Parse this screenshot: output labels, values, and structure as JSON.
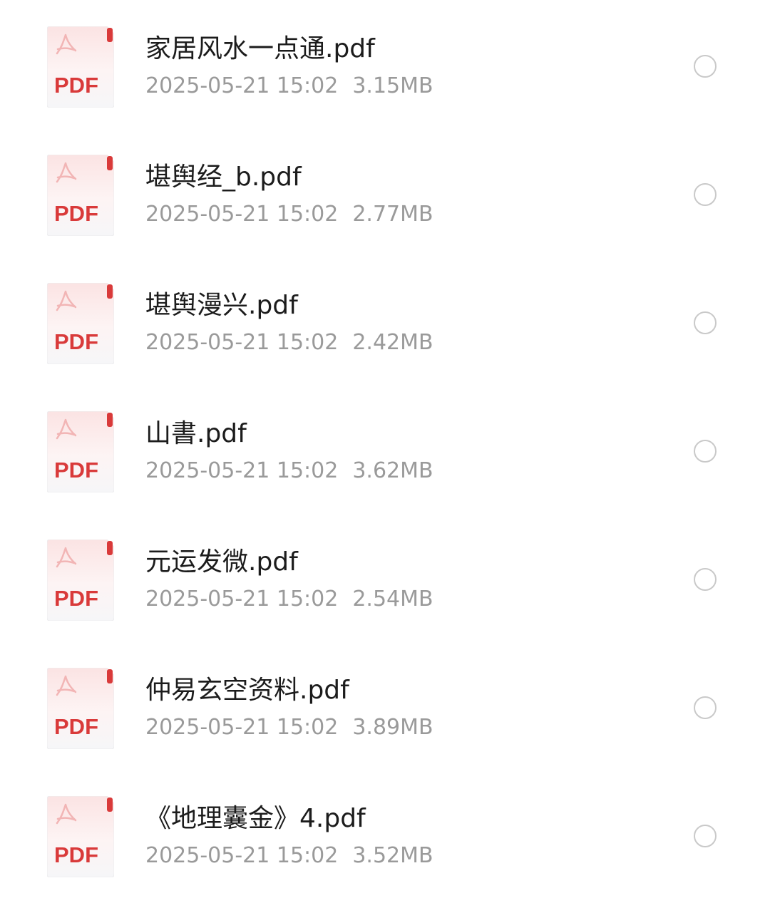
{
  "file_type_icon": "pdf-file-icon",
  "icon_label": "PDF",
  "accent_color": "#d93a3a",
  "files": [
    {
      "name": "家居风水一点通.pdf",
      "date": "2025-05-21 15:02",
      "size": "3.15MB"
    },
    {
      "name": "堪舆经_b.pdf",
      "date": "2025-05-21 15:02",
      "size": "2.77MB"
    },
    {
      "name": "堪舆漫兴.pdf",
      "date": "2025-05-21 15:02",
      "size": "2.42MB"
    },
    {
      "name": "山書.pdf",
      "date": "2025-05-21 15:02",
      "size": "3.62MB"
    },
    {
      "name": "元运发微.pdf",
      "date": "2025-05-21 15:02",
      "size": "2.54MB"
    },
    {
      "name": "仲易玄空资料.pdf",
      "date": "2025-05-21 15:02",
      "size": "3.89MB"
    },
    {
      "name": "《地理囊金》4.pdf",
      "date": "2025-05-21 15:02",
      "size": "3.52MB"
    }
  ]
}
